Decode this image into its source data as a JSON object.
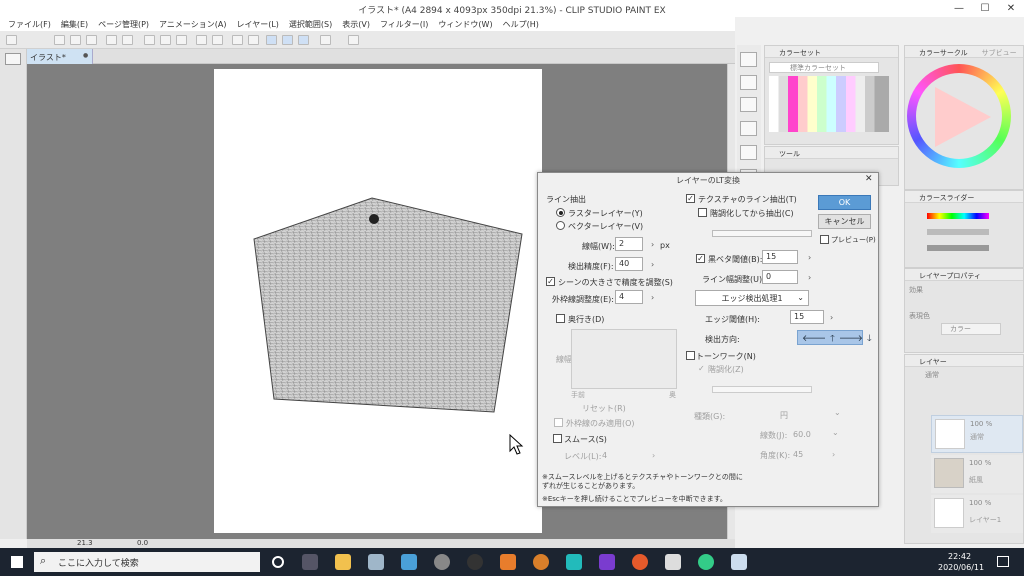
{
  "window": {
    "title": "イラスト* (A4 2894 x 4093px 350dpi 21.3%) - CLIP STUDIO PAINT EX",
    "min": "—",
    "max": "☐",
    "close": "✕"
  },
  "menu": [
    "ファイル(F)",
    "編集(E)",
    "ページ管理(P)",
    "アニメーション(A)",
    "レイヤー(L)",
    "選択範囲(S)",
    "表示(V)",
    "フィルター(I)",
    "ウィンドウ(W)",
    "ヘルプ(H)"
  ],
  "doc_tab": {
    "label": "イラスト*",
    "close": "●"
  },
  "status": {
    "zoom": "21.3",
    "rotation": "0.0"
  },
  "panels": {
    "color_set": "カラーセット",
    "color_set_name": "標準カラーセット",
    "tool": "ツール",
    "color_circle": "カラーサークル",
    "sub_view": "サブビュー",
    "color_slider": "カラースライダー",
    "layer_property": "レイヤープロパティ",
    "effect": "効果",
    "expression_color": "表現色",
    "color_value": "カラー",
    "layer": "レイヤー",
    "blend": "通常",
    "layers": [
      {
        "opacity": "100 %",
        "name": "通常"
      },
      {
        "opacity": "100 %",
        "name": "紙風"
      },
      {
        "opacity": "100 %",
        "name": "レイヤー1"
      }
    ]
  },
  "dialog": {
    "title": "レイヤーのLT変換",
    "line_extract": "ライン抽出",
    "raster_layer": "ラスターレイヤー(Y)",
    "vector_layer": "ベクターレイヤー(V)",
    "line_width_label": "線幅(W):",
    "line_width": "2",
    "line_width_unit": "px",
    "accuracy_label": "検出精度(F):",
    "accuracy": "40",
    "scene_adjust": "シーンの大きさで精度を調整(S)",
    "outline_adjust_label": "外枠線調整度(E):",
    "outline_adjust": "4",
    "depth": "奥行き(D)",
    "line_width_side": "線幅",
    "near": "手前",
    "far": "奥",
    "reset": "リセット(R)",
    "outline_apply": "外枠線のみ適用(O)",
    "smooth": "スムース(S)",
    "level_label": "レベル(L):",
    "level": "4",
    "texture_extract": "テクスチャのライン抽出(T)",
    "posterize_then": "階調化してから抽出(C)",
    "black_threshold_label": "黒ベタ閾値(B):",
    "black_threshold": "15",
    "line_adjust_label": "ライン幅調整(U):",
    "line_adjust": "0",
    "edge_process": "エッジ検出処理1",
    "edge_threshold_label": "エッジ閾値(H):",
    "edge_threshold": "15",
    "direction_label": "検出方向:",
    "tone_work": "トーンワーク(N)",
    "posterize": "階調化(Z)",
    "type_label": "種類(G):",
    "type_value": "円",
    "lines_label": "線数(J):",
    "lines_value": "60.0",
    "angle_label": "角度(K):",
    "angle_value": "45",
    "ok": "OK",
    "cancel": "キャンセル",
    "preview": "プレビュー(P)",
    "note1": "※スムースレベルを上げるとテクスチャやトーンワークとの間に",
    "note2": "ずれが生じることがあります。",
    "note3": "※Escキーを押し続けることでプレビューを中断できます。"
  },
  "taskbar": {
    "search_placeholder": "ここに入力して検索",
    "time": "22:42",
    "date": "2020/06/11"
  }
}
